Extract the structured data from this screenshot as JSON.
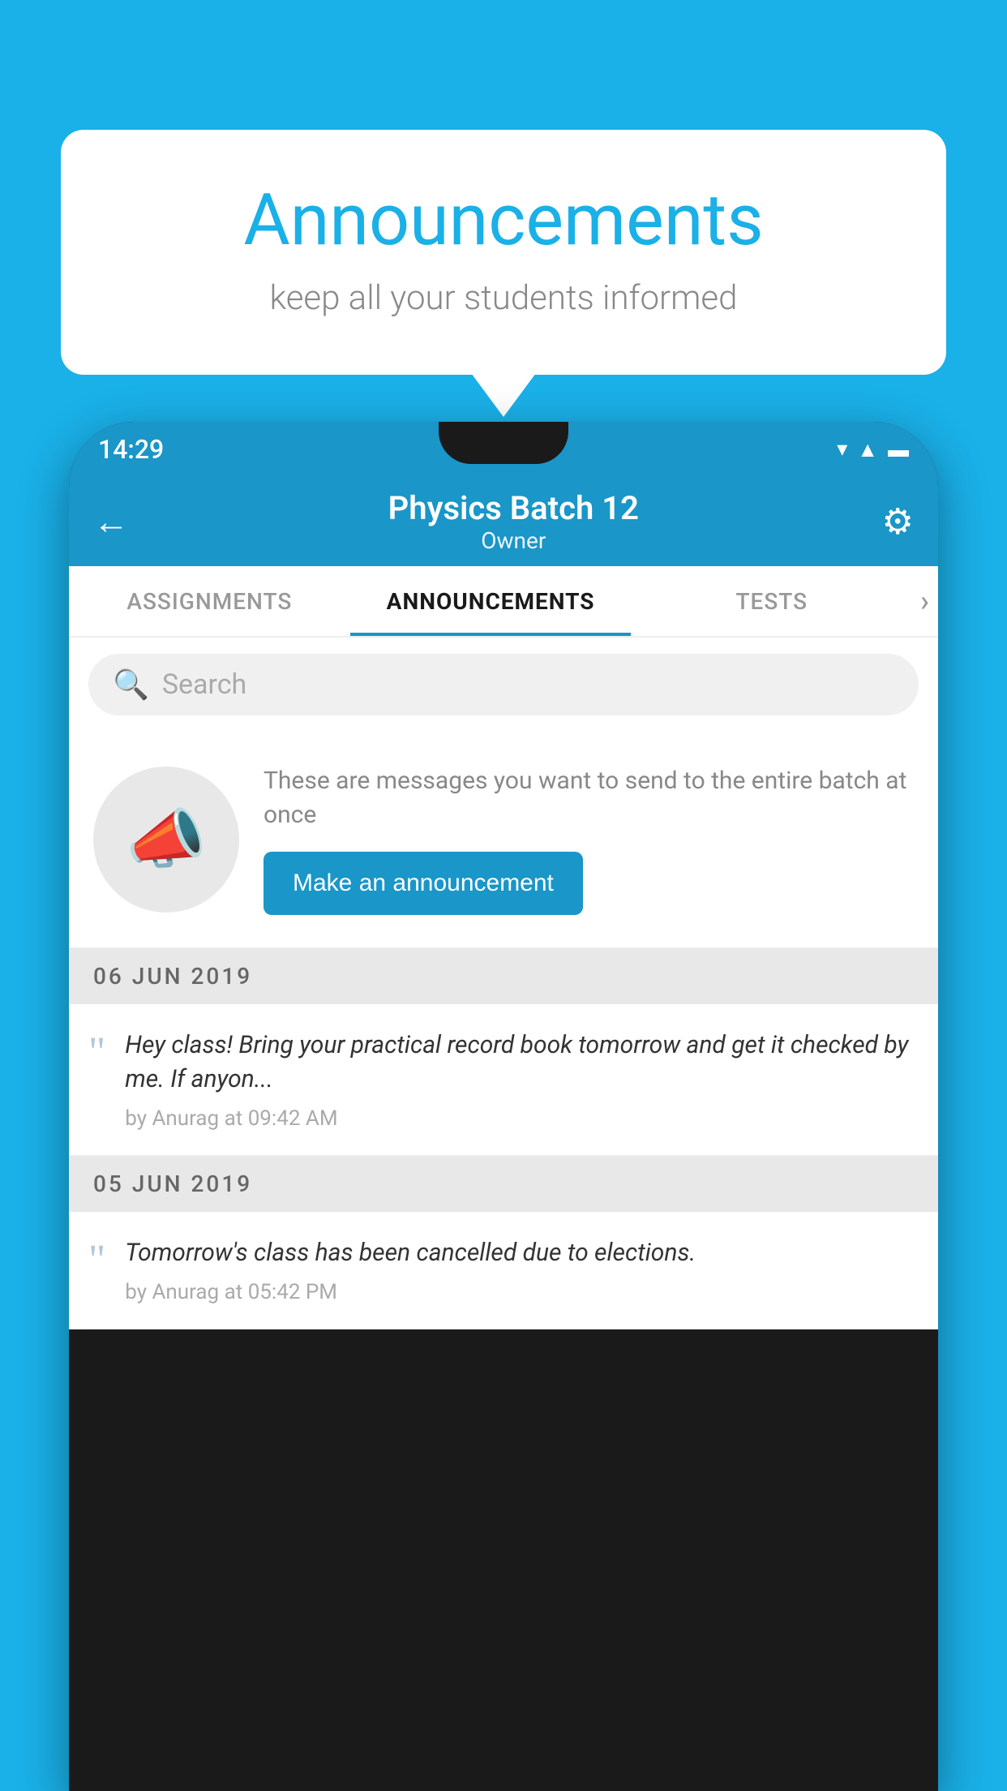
{
  "background_color": "#1ab0e8",
  "speech_bubble": {
    "title": "Announcements",
    "subtitle": "keep all your students informed"
  },
  "phone": {
    "status_bar": {
      "time": "14:29"
    },
    "app_bar": {
      "title": "Physics Batch 12",
      "subtitle": "Owner",
      "back_label": "←",
      "settings_label": "⚙"
    },
    "tabs": [
      {
        "label": "ASSIGNMENTS",
        "active": false
      },
      {
        "label": "ANNOUNCEMENTS",
        "active": true
      },
      {
        "label": "TESTS",
        "active": false
      }
    ],
    "search": {
      "placeholder": "Search"
    },
    "promo": {
      "description": "These are messages you want to send to the entire batch at once",
      "button_label": "Make an announcement"
    },
    "announcements": [
      {
        "date": "06  JUN  2019",
        "message": "Hey class! Bring your practical record book tomorrow and get it checked by me. If anyon...",
        "meta": "by Anurag at 09:42 AM"
      },
      {
        "date": "05  JUN  2019",
        "message": "Tomorrow's class has been cancelled due to elections.",
        "meta": "by Anurag at 05:42 PM"
      }
    ]
  }
}
